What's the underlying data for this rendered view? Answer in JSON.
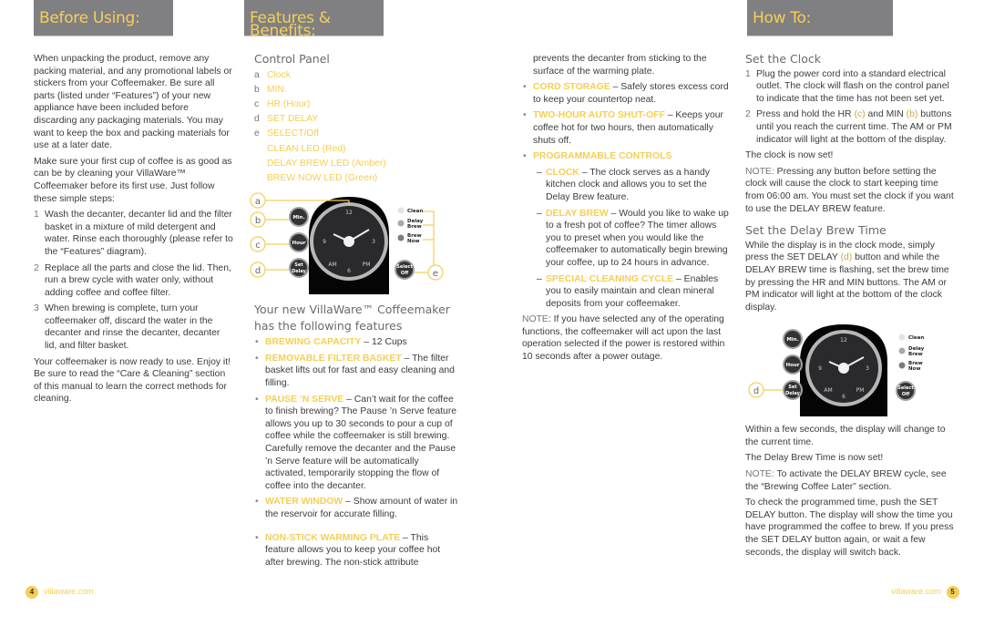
{
  "banners": {
    "before_using": "Before Using:",
    "features": "Features & Benefits:",
    "how_to": "How To:"
  },
  "before_using": {
    "intro": "When unpacking the product, remove any packing material, and any promotional labels or stickers from your Coffeemaker. Be sure all parts (listed under “Features”) of your new appliance have been included before discarding any packaging materials. You may want to keep the box and packing materials for use at a later date.",
    "intro2": "Make sure your first cup of coffee is as good as can be by cleaning your VillaWare™ Coffeemaker before its first use. Just follow these simple steps:",
    "steps": [
      {
        "num": "1",
        "text": "Wash the decanter, decanter lid and the filter basket in a mixture of mild detergent and water. Rinse each thoroughly (please refer to the “Features” diagram)."
      },
      {
        "num": "2",
        "text": "Replace all the parts and close the lid. Then, run a brew cycle with water only, without adding coffee and coffee filter."
      },
      {
        "num": "3",
        "text": "When brewing is complete, turn your coffeemaker off, discard the water in the decanter and rinse the decanter, decanter lid, and filter basket."
      }
    ],
    "outro": "Your coffeemaker is now ready to use. Enjoy it! Be sure to read the “Care & Cleaning” section of this manual to learn the correct methods for cleaning."
  },
  "control_panel": {
    "heading": "Control Panel",
    "items": [
      {
        "letter": "a",
        "label": "Clock"
      },
      {
        "letter": "b",
        "label": "MIN."
      },
      {
        "letter": "c",
        "label": "HR (Hour)"
      },
      {
        "letter": "d",
        "label": "SET DELAY"
      },
      {
        "letter": "e",
        "label": "SELECT/Off"
      },
      {
        "letter": "",
        "label": "CLEAN LED (Red)"
      },
      {
        "letter": "",
        "label": "DELAY BREW LED (Amber)"
      },
      {
        "letter": "",
        "label": "BREW NOW LED (Green)"
      }
    ],
    "diagram": {
      "callouts": [
        "a",
        "b",
        "c",
        "d",
        "e"
      ],
      "buttons": {
        "min": "Min.",
        "hour": "Hour",
        "set1": "Set",
        "set2": "Delay",
        "select1": "Select",
        "select2": "Off"
      },
      "leds": [
        {
          "line1": "Clean",
          "line2": "",
          "color": "#e4e4e4"
        },
        {
          "line1": "Delay",
          "line2": "Brew",
          "color": "#a9a9ab"
        },
        {
          "line1": "Brew",
          "line2": "Now",
          "color": "#7d7d80"
        }
      ],
      "dial": {
        "12": "12",
        "3": "3",
        "6": "6",
        "9": "9",
        "am": "AM",
        "pm": "PM"
      }
    }
  },
  "features": {
    "heading_line1": "Your new VillaWare™ Coffeemaker",
    "heading_line2": "has the following features",
    "items": [
      {
        "kw": "BREWING CAPACITY",
        "text": " – 12 Cups"
      },
      {
        "kw": "REMOVABLE FILTER BASKET",
        "text": " – The filter basket lifts out for fast and easy cleaning and filling."
      },
      {
        "kw": "PAUSE ‘N SERVE",
        "text": " – Can’t wait for the coffee to finish brewing? The Pause ’n Serve feature allows you up to 30 seconds to pour a cup of coffee while the coffeemaker is still brewing. Carefully remove the decanter and the Pause ’n Serve feature will be automatically activated, temporarily stopping the flow of coffee into the decanter."
      },
      {
        "kw": "WATER WINDOW",
        "text": " – Show amount of water in the reservoir for accurate filling."
      },
      {
        "kw": "NON-STICK WARMING PLATE",
        "text": " – This feature allows you to keep your coffee hot after brewing. The non-stick attribute"
      }
    ],
    "continued": "prevents the decanter from sticking to the surface of the warming plate.",
    "items2": [
      {
        "kw": "CORD STORAGE",
        "text": " – Safely stores excess cord to keep your countertop neat."
      },
      {
        "kw": "TWO-HOUR AUTO SHUT-OFF",
        "text": " – Keeps your coffee hot for two hours, then automatically shuts off."
      },
      {
        "kw": "PROGRAMMABLE CONTROLS",
        "text": ""
      }
    ],
    "sub_items": [
      {
        "kw": "CLOCK",
        "text": " – The clock serves as a handy kitchen clock and allows you to set the Delay Brew feature."
      },
      {
        "kw": "DELAY BREW",
        "text": " – Would you like to wake up to a fresh pot of coffee? The timer allows you to preset when you would like the coffeemaker to automatically begin brewing your coffee, up to 24 hours in advance."
      },
      {
        "kw": "SPECIAL CLEANING CYCLE",
        "text": " – Enables you to easily maintain and clean mineral deposits from your coffeemaker."
      }
    ],
    "note_label": "NOTE",
    "note_text": ": If you have selected any of the operating functions, the coffeemaker will act upon the last operation selected if the power is restored within 10 seconds after a power outage."
  },
  "how_to": {
    "set_clock": {
      "heading": "Set the Clock",
      "steps": [
        {
          "num": "1",
          "text": "Plug the power cord into a standard electrical outlet. The clock will flash on the control panel to indicate that the time has not been set yet."
        },
        {
          "num": "2",
          "pre": "Press and hold the HR ",
          "c": "(c)",
          "mid": " and MIN ",
          "b": "(b)",
          "post": " buttons until you reach the current time. The AM or PM indicator will light at the bottom of the display."
        }
      ],
      "done": "The clock is now set!",
      "note_label": "NOTE:",
      "note_text": " Pressing any button before setting the clock will cause the clock to start keeping time from 06:00 am. You must set the clock if you want to use the DELAY BREW feature."
    },
    "set_delay": {
      "heading": "Set the Delay Brew Time",
      "pre": "While the display is in the clock mode, simply press the SET DELAY ",
      "d": "(d)",
      "post": " button and while the DELAY BREW time is flashing, set the brew time by pressing the HR and MIN buttons. The AM or PM indicator will light at the bottom of the clock display.",
      "after1": "Within a few seconds, the display will change to the current time.",
      "after2": "The Delay Brew Time is now set!",
      "note_label": "NOTE:",
      "note_text": " To activate the DELAY BREW cycle, see the “Brewing Coffee Later” section.",
      "check": "To check the programmed time, push the SET DELAY button. The display will show the time you have programmed the coffee to brew. If you press the SET DELAY button again, or wait a few seconds, the display will switch back.",
      "callout": "d"
    }
  },
  "footer": {
    "left_page": "4",
    "left_site": "villaware.com",
    "right_page": "5",
    "right_site": "villaware.com"
  }
}
